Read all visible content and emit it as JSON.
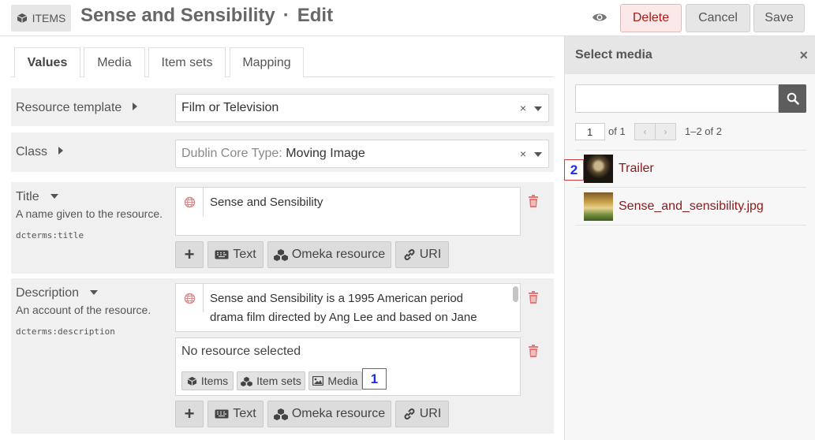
{
  "header": {
    "badge_label": "ITEMS",
    "title": "Sense and Sensibility",
    "separator": "·",
    "mode": "Edit",
    "delete_label": "Delete",
    "cancel_label": "Cancel",
    "save_label": "Save"
  },
  "tabs": [
    {
      "label": "Values"
    },
    {
      "label": "Media"
    },
    {
      "label": "Item sets"
    },
    {
      "label": "Mapping"
    }
  ],
  "resource_template": {
    "label": "Resource template",
    "value": "Film or Television",
    "clear": "×"
  },
  "class": {
    "label": "Class",
    "prefix": "Dublin Core Type",
    "separator": ":",
    "value": "Moving Image",
    "clear": "×"
  },
  "title_prop": {
    "label": "Title",
    "description": "A name given to the resource.",
    "term": "dcterms:title",
    "value": "Sense and Sensibility"
  },
  "description_prop": {
    "label": "Description",
    "description": "An account of the resource.",
    "term": "dcterms:description",
    "value_line1": "Sense and Sensibility is a 1995 American period",
    "value_line2": "drama film directed by Ang Lee and based on Jane",
    "resource_value": "No resource selected"
  },
  "value_types": {
    "add": "+",
    "text": "Text",
    "omeka": "Omeka resource",
    "uri": "URI"
  },
  "resource_buttons": {
    "items": "Items",
    "item_sets": "Item sets",
    "media": "Media"
  },
  "markers": {
    "one": "1",
    "two": "2"
  },
  "sidebar": {
    "title": "Select media",
    "close": "×",
    "search_value": "",
    "page_value": "1",
    "page_of": "of 1",
    "prev": "‹",
    "next": "›",
    "range": "1–2 of 2",
    "items": [
      {
        "label": "Trailer"
      },
      {
        "label": "Sense_and_sensibility.jpg"
      }
    ]
  },
  "colors": {
    "delete": "#a91919",
    "link": "#8b1a1a",
    "marker_border": "#d23c3c",
    "marker_text": "#1a2fe0"
  }
}
